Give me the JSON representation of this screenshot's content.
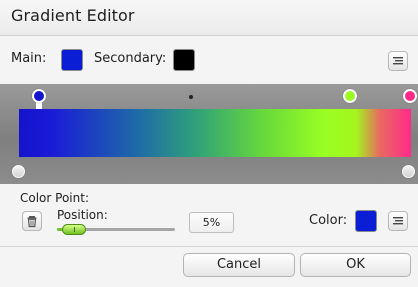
{
  "window": {
    "title": "Gradient Editor"
  },
  "colors": {
    "main": "#0a1ed6",
    "secondary": "#000000",
    "stops": [
      "#1414cc",
      "#99ff22",
      "#ff2a8a"
    ],
    "slider_accent": "#6bc62a"
  },
  "main_row": {
    "main_label": "Main:",
    "secondary_label": "Secondary:",
    "menu_icon": "menu-icon"
  },
  "color_point": {
    "section_label": "Color Point:",
    "delete_icon": "trash-icon",
    "position_label": "Position:",
    "position_value": "5%",
    "position_fraction": 0.05,
    "color_label": "Color:",
    "color_value": "#0a1ed6"
  },
  "footer": {
    "cancel_label": "Cancel",
    "ok_label": "OK"
  }
}
